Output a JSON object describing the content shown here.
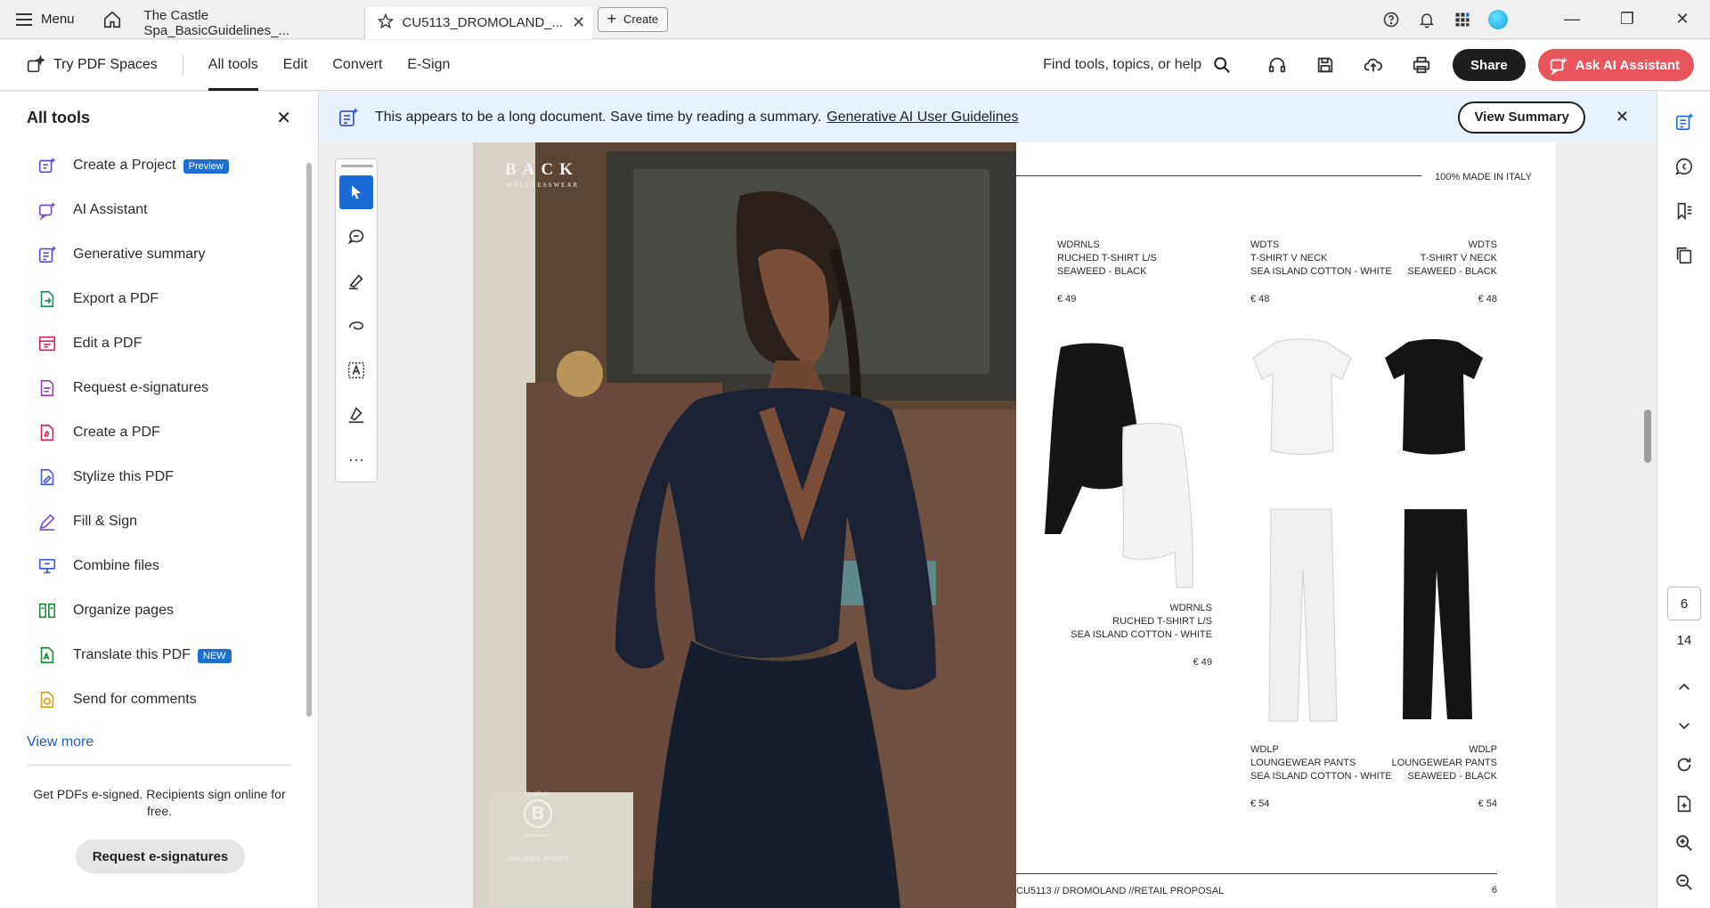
{
  "titlebar": {
    "menu_label": "Menu",
    "tabs": [
      {
        "label": "The Castle Spa_BasicGuidelines_..."
      },
      {
        "label": "CU5113_DROMOLAND_..."
      }
    ],
    "create_label": "Create"
  },
  "toolbar": {
    "try_label": "Try PDF Spaces",
    "nav": [
      "All tools",
      "Edit",
      "Convert",
      "E-Sign"
    ],
    "find_label": "Find tools, topics, or help",
    "share_label": "Share",
    "ai_label": "Ask AI Assistant"
  },
  "leftpanel": {
    "title": "All tools",
    "items": [
      {
        "label": "Create a Project",
        "badge": "Preview",
        "icon": "project-icon"
      },
      {
        "label": "AI Assistant",
        "icon": "ai-assistant-icon"
      },
      {
        "label": "Generative summary",
        "icon": "summary-icon"
      },
      {
        "label": "Export a PDF",
        "icon": "export-pdf-icon"
      },
      {
        "label": "Edit a PDF",
        "icon": "edit-pdf-icon"
      },
      {
        "label": "Request e-signatures",
        "icon": "request-sign-icon"
      },
      {
        "label": "Create a PDF",
        "icon": "create-pdf-icon"
      },
      {
        "label": "Stylize this PDF",
        "icon": "stylize-icon"
      },
      {
        "label": "Fill & Sign",
        "icon": "fill-sign-icon"
      },
      {
        "label": "Combine files",
        "icon": "combine-icon"
      },
      {
        "label": "Organize pages",
        "icon": "organize-icon"
      },
      {
        "label": "Translate this PDF",
        "badge": "NEW",
        "icon": "translate-icon"
      },
      {
        "label": "Send for comments",
        "icon": "send-comments-icon"
      }
    ],
    "view_more": "View more",
    "promo_text": "Get PDFs e-signed. Recipients sign online for free.",
    "promo_button": "Request e-signatures"
  },
  "banner": {
    "text": "This appears to be a long document. Save time by reading a summary.",
    "link": "Generative AI User Guidelines",
    "button": "View Summary"
  },
  "document": {
    "brand": "BACK",
    "brand_sub": "WELLNESSWEAR",
    "certified": "Certified",
    "corporation": "Corporation",
    "made_in_photo": "100% MADE IN ITALY",
    "made_in_italy": "100% MADE IN ITALY",
    "products": [
      {
        "code": "WDRNLS",
        "name": "RUCHED T-SHIRT L/S",
        "material": "SEAWEED - BLACK",
        "price": "€ 49"
      },
      {
        "code": "WDTS",
        "name": "T-SHIRT V NECK",
        "material": "SEA ISLAND COTTON - WHITE",
        "price": "€ 48"
      },
      {
        "code": "WDTS",
        "name": "T-SHIRT V NECK",
        "material": "SEAWEED - BLACK",
        "price": "€ 48"
      },
      {
        "code": "WDRNLS",
        "name": "RUCHED T-SHIRT L/S",
        "material": "SEA ISLAND COTTON - WHITE",
        "price": "€ 49"
      },
      {
        "code": "WDLP",
        "name": "LOUNGEWEAR PANTS",
        "material": "SEA ISLAND COTTON - WHITE",
        "price": "€ 54"
      },
      {
        "code": "WDLP",
        "name": "LOUNGEWEAR PANTS",
        "material": "SEAWEED - BLACK",
        "price": "€ 54"
      }
    ],
    "footer": "CU5113 // DROMOLAND //RETAIL PROPOSAL",
    "page_number": "6"
  },
  "pager": {
    "current": "6",
    "total": "14"
  },
  "colors": {
    "accent": "#1b6bd7",
    "ai_button": "#e8565c",
    "banner": "#e6f1fb"
  }
}
